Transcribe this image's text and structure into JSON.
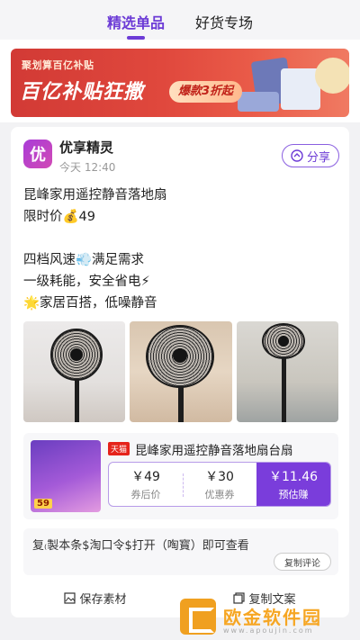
{
  "tabs": [
    {
      "label": "精选单品",
      "active": true
    },
    {
      "label": "好货专场",
      "active": false
    }
  ],
  "banner": {
    "sub": "聚划算百亿补贴",
    "headline": "百亿补贴狂撒",
    "pill": "爆款3折起"
  },
  "post": {
    "avatar_char": "优",
    "author": "优享精灵",
    "time": "今天 12:40",
    "share_label": "分享",
    "lines": [
      "昆峰家用遥控静音落地扇",
      "限时价💰49",
      "",
      "四档风速💨满足需求",
      "一级耗能，安全省电⚡",
      "🌟家居百搭，低噪静音"
    ]
  },
  "product": {
    "thumb_badge": "59",
    "shop_badge": "天猫",
    "title": "昆峰家用遥控静音落地扇台扇",
    "prices": [
      {
        "value": "￥49",
        "label": "券后价"
      },
      {
        "value": "￥30",
        "label": "优惠券"
      },
      {
        "value": "￥11.46",
        "label": "预估赚"
      }
    ]
  },
  "copy": {
    "text": "复₍製本条$淘口令$打开（啕寳）即可查看",
    "button": "复制评论"
  },
  "actions": {
    "save": "保存素材",
    "copy": "复制文案"
  },
  "watermark": {
    "text": "欧金软件园",
    "url": "www.apoujin.com"
  }
}
